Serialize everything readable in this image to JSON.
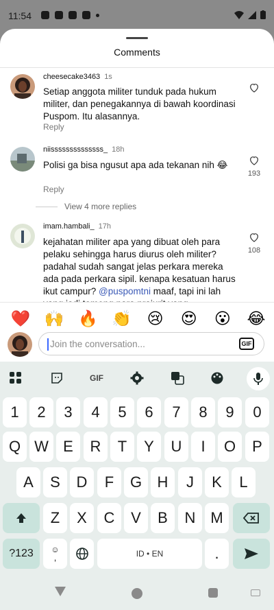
{
  "status": {
    "time": "11:54"
  },
  "sheet": {
    "title": "Comments"
  },
  "comments": [
    {
      "user": "cheesecake3463",
      "time": "1s",
      "text": "Setiap anggota militer tunduk pada hukum militer, dan penegakannya di bawah koordinasi Puspom. Itu alasannya.",
      "reply": "Reply",
      "likes": ""
    },
    {
      "user": "niissssssssssssss_",
      "time": "18h",
      "text": "Polisi ga bisa ngusut apa ada tekanan nih 😂",
      "reply": "Reply",
      "likes": "193",
      "more": "View 4 more replies"
    },
    {
      "user": "imam.hambali_",
      "time": "17h",
      "text_before": "kejahatan militer apa yang dibuat oleh para pelaku sehingga harus diurus oleh militer? padahal sudah sangat jelas perkara mereka ada pada perkara sipil. kenapa kesatuan harus ikut campur? ",
      "mention": "@puspomtni",
      "text_after": " maaf, tapi ini lah yang jadi tameng para prajurit yang",
      "likes": "108"
    }
  ],
  "emojis": [
    "❤️",
    "🙌",
    "🔥",
    "👏",
    "😢",
    "😍",
    "😮",
    "😂"
  ],
  "composer": {
    "placeholder": "Join the conversation...",
    "gif": "GIF"
  },
  "keyboard": {
    "toolbar": {
      "gif": "GIF"
    },
    "row_numbers": [
      "1",
      "2",
      "3",
      "4",
      "5",
      "6",
      "7",
      "8",
      "9",
      "0"
    ],
    "row1": [
      "Q",
      "W",
      "E",
      "R",
      "T",
      "Y",
      "U",
      "I",
      "O",
      "P"
    ],
    "row2": [
      "A",
      "S",
      "D",
      "F",
      "G",
      "H",
      "J",
      "K",
      "L"
    ],
    "row3": [
      "Z",
      "X",
      "C",
      "V",
      "B",
      "N",
      "M"
    ],
    "symbols": "?123",
    "comma": ",",
    "space": "ID • EN",
    "period": "."
  }
}
